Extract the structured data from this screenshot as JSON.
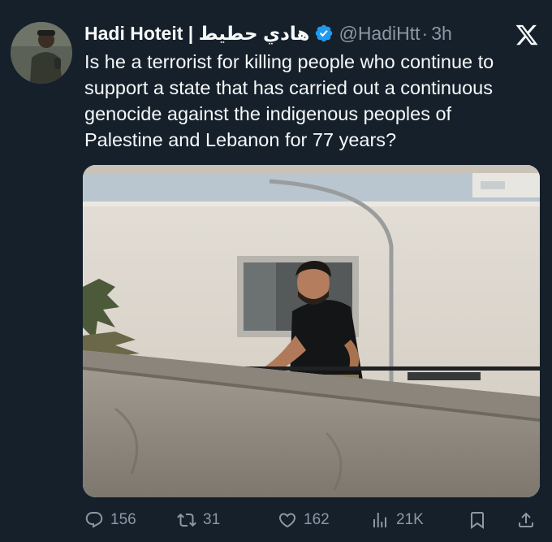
{
  "tweet": {
    "display_name": "Hadi Hoteit | هادي حطيط",
    "handle": "@HadiHtt",
    "separator": "·",
    "time": "3h",
    "verified_icon": "verified-badge-icon",
    "platform_icon": "x-logo-icon",
    "text_lines": [
      "Is he a terrorist for killing people who continue to",
      "support a state that has carried out a continuous",
      "genocide against the indigenous peoples of",
      "Palestine and Lebanon for 77 years?"
    ]
  },
  "actions": {
    "replies": "156",
    "reposts": "31",
    "likes": "162",
    "views": "21K"
  },
  "colors": {
    "background": "#15202b",
    "text": "#f7f9f9",
    "secondary_text": "#8b98a5",
    "verified": "#1d9bf0"
  }
}
